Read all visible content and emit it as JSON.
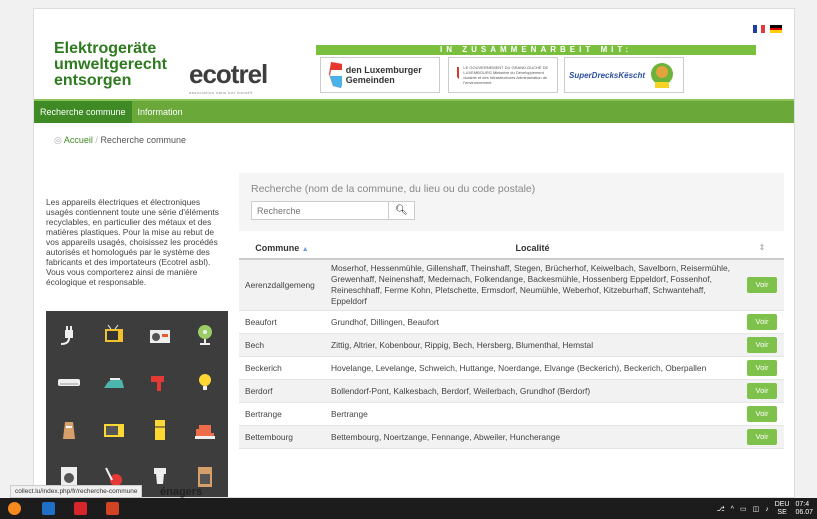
{
  "brand": {
    "line1": "Elektrogeräte",
    "line2": "umweltgerecht",
    "line3": "entsorgen"
  },
  "ecotrel": {
    "name": "ecotrel",
    "tagline": "association sans but lucratif"
  },
  "collab": {
    "label": "IN ZUSAMMENARBEIT MIT:"
  },
  "partners": {
    "municipalities": "den Luxemburger Gemeinden",
    "government": "LE GOUVERNEMENT DU GRAND-DUCHÉ DE LUXEMBOURG Ministère du Développement durable et des Infrastructures Administration de l'environnement",
    "sdk": "SuperDrecksKëscht"
  },
  "nav": {
    "tab_recherche": "Recherche commune",
    "tab_information": "Information"
  },
  "breadcrumb": {
    "home": "Accueil",
    "separator": "/",
    "current": "Recherche commune"
  },
  "intro_text": "Les appareils électriques et électroniques usagés contiennent toute une série d'éléments recyclables, en particulier des métaux et des matières plastiques. Pour la mise au rebut de vos appareils usagés, choisissez les procédés autorisés et homologués par le système des fabricants et des importateurs (Ecotrel asbl). Vous vous comporterez ainsi de manière écologique et responsable.",
  "search": {
    "label": "Recherche (nom de la commune, du lieu ou du code postale)",
    "placeholder": "Recherche"
  },
  "table": {
    "headers": {
      "commune": "Commune",
      "localite": "Localité"
    },
    "button_label": "Voir",
    "rows": [
      {
        "commune": "Aerenzdallgemeng",
        "localites": "Moserhof, Hessenmühle, Gillenshaff, Theinshaff, Stegen, Brücherhof, Keiwelbach, Savelborn, Reisermühle, Grewenhaff, Neinenshaff, Medernach, Folkendange, Backesmühle, Hossenberg Eppeldorf, Fossenhof, Reineschhaff, Ferme Kohn, Pletschette, Ermsdorf, Neumühle, Weberhof, Kitzeburhaff, Schwantehaff, Eppeldorf"
      },
      {
        "commune": "Beaufort",
        "localites": "Grundhof, Dillingen, Beaufort"
      },
      {
        "commune": "Bech",
        "localites": "Zittig, Altrier, Kobenbour, Rippig, Bech, Hersberg, Blumenthal, Hemstal"
      },
      {
        "commune": "Beckerich",
        "localites": "Hovelange, Levelange, Schweich, Huttange, Noerdange, Elvange (Beckerich), Beckerich, Oberpallen"
      },
      {
        "commune": "Berdorf",
        "localites": "Bollendorf-Pont, Kalkesbach, Berdorf, Weilerbach, Grundhof (Berdorf)"
      },
      {
        "commune": "Bertrange",
        "localites": "Bertrange"
      },
      {
        "commune": "Bettembourg",
        "localites": "Bettembourg, Noertzange, Fennange, Abweiler, Huncherange"
      }
    ]
  },
  "status_url": "collect.lu/index.php/fr/recherche-commune",
  "partial_heading": "énagers",
  "taskbar": {
    "lang_top": "DEU",
    "lang_bottom": "SE",
    "time": "07:4",
    "date": "06.07"
  }
}
